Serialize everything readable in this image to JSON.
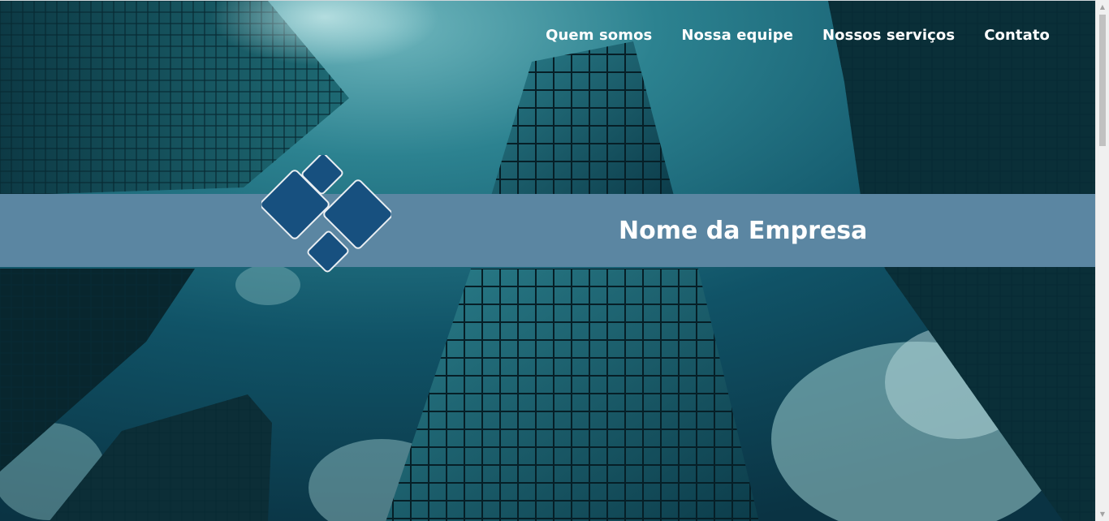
{
  "nav": {
    "items": [
      {
        "label": "Quem somos"
      },
      {
        "label": "Nossa equipe"
      },
      {
        "label": "Nossos serviços"
      },
      {
        "label": "Contato"
      }
    ]
  },
  "header": {
    "company_name": "Nome da Empresa"
  },
  "colors": {
    "band": "#5b86a2",
    "logo_tile": "#17507f",
    "nav_text": "#ffffff",
    "sky_dark": "#0b3542",
    "sky_light": "#2a7f8c"
  },
  "icons": {
    "logo": "diamond-tiles-logo",
    "scroll_up": "triangle-up",
    "scroll_down": "triangle-down"
  }
}
